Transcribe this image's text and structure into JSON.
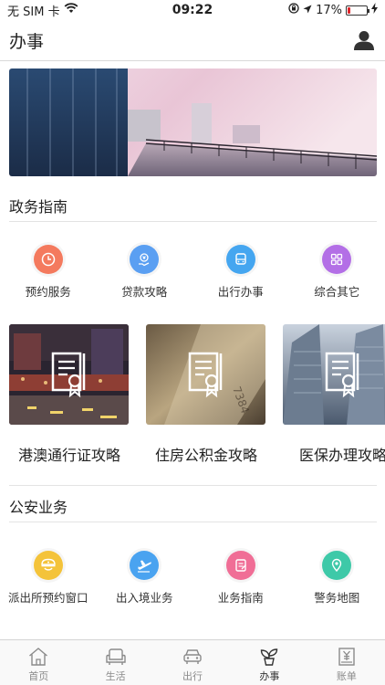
{
  "status_bar": {
    "carrier": "无 SIM 卡",
    "time": "09:22",
    "battery_percent": "17%",
    "battery_level": 0.17
  },
  "header": {
    "title": "办事"
  },
  "gov_guide": {
    "title": "政务指南",
    "items": [
      {
        "label": "预约服务",
        "icon": "clock-icon",
        "color": "#f47a5e"
      },
      {
        "label": "贷款攻略",
        "icon": "money-hand-icon",
        "color": "#5a9ff2"
      },
      {
        "label": "出行办事",
        "icon": "bus-icon",
        "color": "#45a6f0"
      },
      {
        "label": "综合其它",
        "icon": "grid-icon",
        "color": "#b36fe6"
      }
    ]
  },
  "cards": [
    {
      "title": "港澳通行证攻略"
    },
    {
      "title": "住房公积金攻略"
    },
    {
      "title": "医保办理攻略"
    }
  ],
  "police": {
    "title": "公安业务",
    "items": [
      {
        "label": "派出所预约窗口",
        "icon": "police-cap-icon",
        "color": "#f4c33a"
      },
      {
        "label": "出入境业务",
        "icon": "airplane-icon",
        "color": "#4aa3f0"
      },
      {
        "label": "业务指南",
        "icon": "document-icon",
        "color": "#f06e96"
      },
      {
        "label": "警务地图",
        "icon": "map-pin-icon",
        "color": "#3ec9a8"
      }
    ]
  },
  "tab_bar": {
    "tabs": [
      {
        "label": "首页",
        "icon": "home-icon"
      },
      {
        "label": "生活",
        "icon": "sofa-icon"
      },
      {
        "label": "出行",
        "icon": "car-icon"
      },
      {
        "label": "办事",
        "icon": "sprout-icon",
        "active": true
      },
      {
        "label": "账单",
        "icon": "bill-icon"
      }
    ]
  }
}
